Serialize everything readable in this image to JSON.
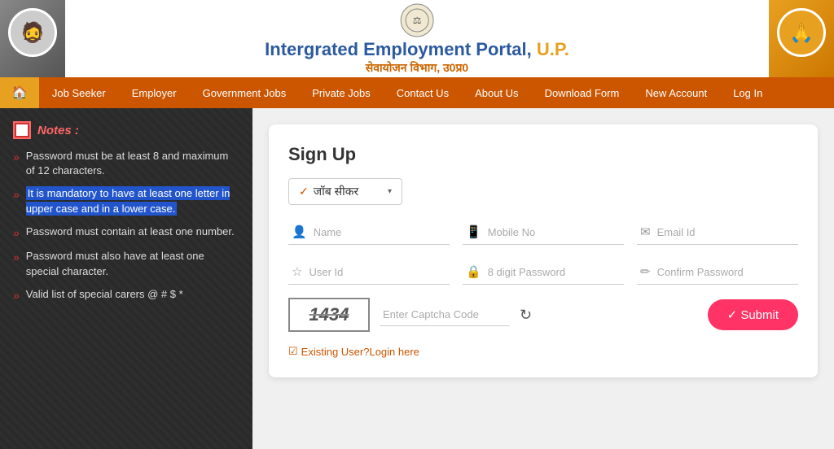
{
  "header": {
    "title_main": "Intergrated Employment Portal, U.P.",
    "title_main_regular": "Intergrated Employment Portal, ",
    "title_main_accent": "U.P.",
    "title_sub": "सेवायोजन विभाग, उ0प्र0",
    "emblem_label": "Government Emblem"
  },
  "nav": {
    "home_icon": "🏠",
    "items": [
      {
        "label": "Job Seeker",
        "id": "job-seeker"
      },
      {
        "label": "Employer",
        "id": "employer"
      },
      {
        "label": "Government Jobs",
        "id": "government-jobs"
      },
      {
        "label": "Private Jobs",
        "id": "private-jobs"
      },
      {
        "label": "Contact Us",
        "id": "contact-us"
      },
      {
        "label": "About Us",
        "id": "about-us"
      },
      {
        "label": "Download Form",
        "id": "download-form"
      },
      {
        "label": "New Account",
        "id": "new-account"
      },
      {
        "label": "Log In",
        "id": "log-in"
      }
    ]
  },
  "sidebar": {
    "notes_label": "Notes :",
    "items": [
      {
        "text": "Password must be at least 8 and maximum of 12 characters.",
        "highlight": false
      },
      {
        "text": "It is mandatory to have at least one letter in upper case and in a lower case.",
        "highlight": true
      },
      {
        "text": "Password must contain at least one number.",
        "highlight": false
      },
      {
        "text": "Password must also have at least one special character.",
        "highlight": false
      },
      {
        "text": "Valid list of special carers @ # $ *",
        "highlight": false
      }
    ]
  },
  "form": {
    "title": "Sign Up",
    "role_check": "✓",
    "role_label": "जॉब सीकर",
    "role_arrow": "▾",
    "fields_row1": [
      {
        "placeholder": "Name",
        "icon": "👤",
        "id": "name-field"
      },
      {
        "placeholder": "Mobile No",
        "icon": "📱",
        "id": "mobile-field"
      },
      {
        "placeholder": "Email Id",
        "icon": "✉",
        "id": "email-field"
      }
    ],
    "fields_row2": [
      {
        "placeholder": "User Id",
        "icon": "☆",
        "id": "userid-field"
      },
      {
        "placeholder": "8 digit Password",
        "icon": "🔒",
        "id": "password-field",
        "type": "password"
      },
      {
        "placeholder": "Confirm Password",
        "icon": "✏",
        "id": "confirm-password-field",
        "type": "password"
      }
    ],
    "captcha_value": "1434",
    "captcha_placeholder": "Enter Captcha Code",
    "refresh_icon": "↻",
    "submit_label": "✓ Submit",
    "login_link_check": "☑",
    "login_link_label": "Existing User?Login here"
  },
  "colors": {
    "brand_orange": "#cc5500",
    "brand_blue": "#2c5aa0",
    "brand_gold": "#e8a020",
    "nav_bg": "#cc5500",
    "highlight_bg": "#2255cc"
  }
}
